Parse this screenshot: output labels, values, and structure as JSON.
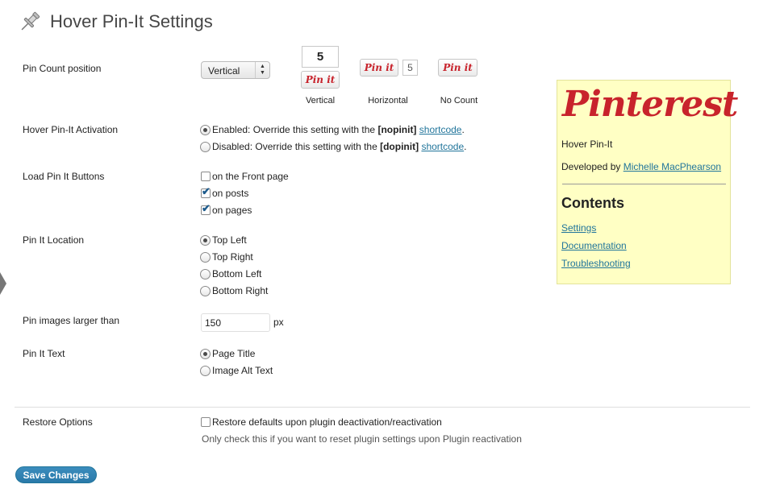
{
  "header": {
    "title": "Hover Pin-It Settings",
    "icon": "pushpin-icon"
  },
  "pin_count_position": {
    "label": "Pin Count position",
    "select_value": "Vertical",
    "previews": [
      {
        "caption": "Vertical",
        "count": "5",
        "button_text": "Pin it"
      },
      {
        "caption": "Horizontal",
        "count": "5",
        "button_text": "Pin it"
      },
      {
        "caption": "No Count",
        "button_text": "Pin it"
      }
    ]
  },
  "activation": {
    "label": "Hover Pin-It Activation",
    "options": [
      {
        "prefix": "Enabled: Override this setting with the ",
        "code": "[nopinit]",
        "link": "shortcode",
        "suffix": ".",
        "selected": true
      },
      {
        "prefix": "Disabled: Override this setting with the ",
        "code": "[dopinit]",
        "link": "shortcode",
        "suffix": ".",
        "selected": false
      }
    ]
  },
  "load_buttons": {
    "label": "Load Pin It Buttons",
    "options": [
      {
        "label": "on the Front page",
        "checked": false
      },
      {
        "label": "on posts",
        "checked": true
      },
      {
        "label": "on pages",
        "checked": true
      }
    ]
  },
  "location": {
    "label": "Pin It Location",
    "options": [
      {
        "label": "Top Left",
        "selected": true
      },
      {
        "label": "Top Right",
        "selected": false
      },
      {
        "label": "Bottom Left",
        "selected": false
      },
      {
        "label": "Bottom Right",
        "selected": false
      }
    ]
  },
  "min_size": {
    "label": "Pin images larger than",
    "value": "150",
    "unit": "px"
  },
  "pin_text": {
    "label": "Pin It Text",
    "options": [
      {
        "label": "Page Title",
        "selected": true
      },
      {
        "label": "Image Alt Text",
        "selected": false
      }
    ]
  },
  "restore": {
    "label": "Restore Options",
    "checkbox_label": "Restore defaults upon plugin deactivation/reactivation",
    "checked": false,
    "note": "Only check this if you want to reset plugin settings upon Plugin reactivation"
  },
  "save_button": "Save Changes",
  "sidebar": {
    "logo": "Pinterest",
    "plugin_name": "Hover Pin-It",
    "developed_by": "Developed by ",
    "developer": "Michelle MacPhearson",
    "contents_heading": "Contents",
    "links": [
      "Settings",
      "Documentation",
      "Troubleshooting"
    ]
  },
  "colors": {
    "pinterest_red": "#c8232c",
    "link_blue": "#21759b",
    "sidebar_bg": "#ffffc4",
    "primary_button": "#2a7aa9"
  }
}
